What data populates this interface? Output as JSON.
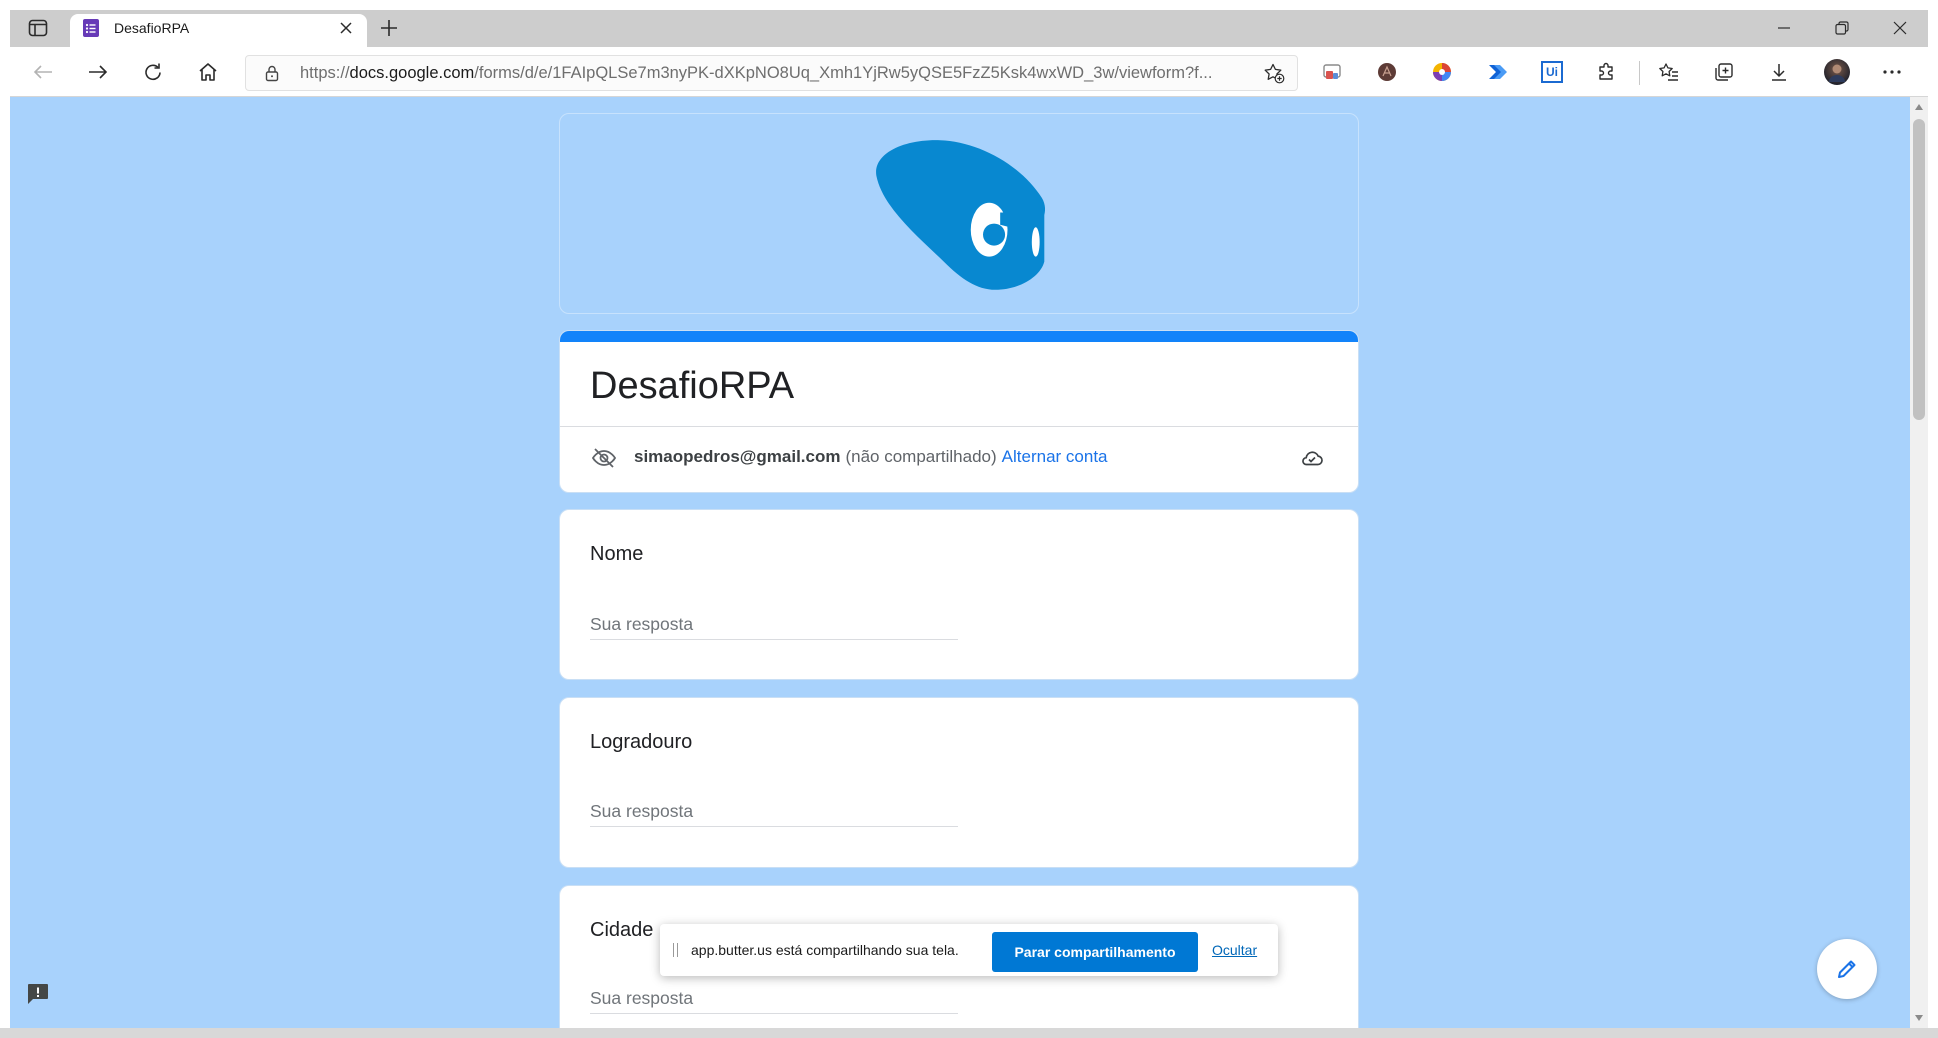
{
  "browser": {
    "tab": {
      "title": "DesafioRPA"
    },
    "url": {
      "scheme": "https://",
      "host": "docs.google.com",
      "path": "/forms/d/e/1FAIpQLSe7m3nyPK-dXKpNO8Uq_Xmh1YjRw5yQSE5FzZ5Ksk4wxWD_3w/viewform?f..."
    },
    "toolbar_icons": [
      "back-icon",
      "forward-icon",
      "refresh-icon",
      "home-icon",
      "lock-icon",
      "add-favorite-icon"
    ],
    "extensions": {
      "icons": [
        "cast-extension-icon",
        "avatar-extension-icon",
        "color-extension-icon",
        "power-automate-icon",
        "uipath-icon",
        "extensions-puzzle-icon"
      ],
      "uipath_label": "Ui"
    },
    "right_icons": [
      "favorites-icon",
      "collections-icon",
      "downloads-icon",
      "profile-avatar",
      "more-icon"
    ]
  },
  "form": {
    "title": "DesafioRPA",
    "account": {
      "email": "simaopedros@gmail.com",
      "sharing_note": "(não compartilhado)",
      "switch_account": "Alternar conta"
    },
    "questions": [
      {
        "label": "Nome",
        "placeholder": "Sua resposta"
      },
      {
        "label": "Logradouro",
        "placeholder": "Sua resposta"
      },
      {
        "label": "Cidade",
        "placeholder": "Sua resposta"
      }
    ]
  },
  "share_bar": {
    "message": "app.butter.us está compartilhando sua tela.",
    "stop_button": "Parar compartilhamento",
    "hide_link": "Ocultar"
  },
  "colors": {
    "page_bg": "#a8d2fc",
    "accent": "#1283fa",
    "link": "#1a73e8",
    "share_btn": "#0078d4",
    "logo": "#0888d0"
  }
}
